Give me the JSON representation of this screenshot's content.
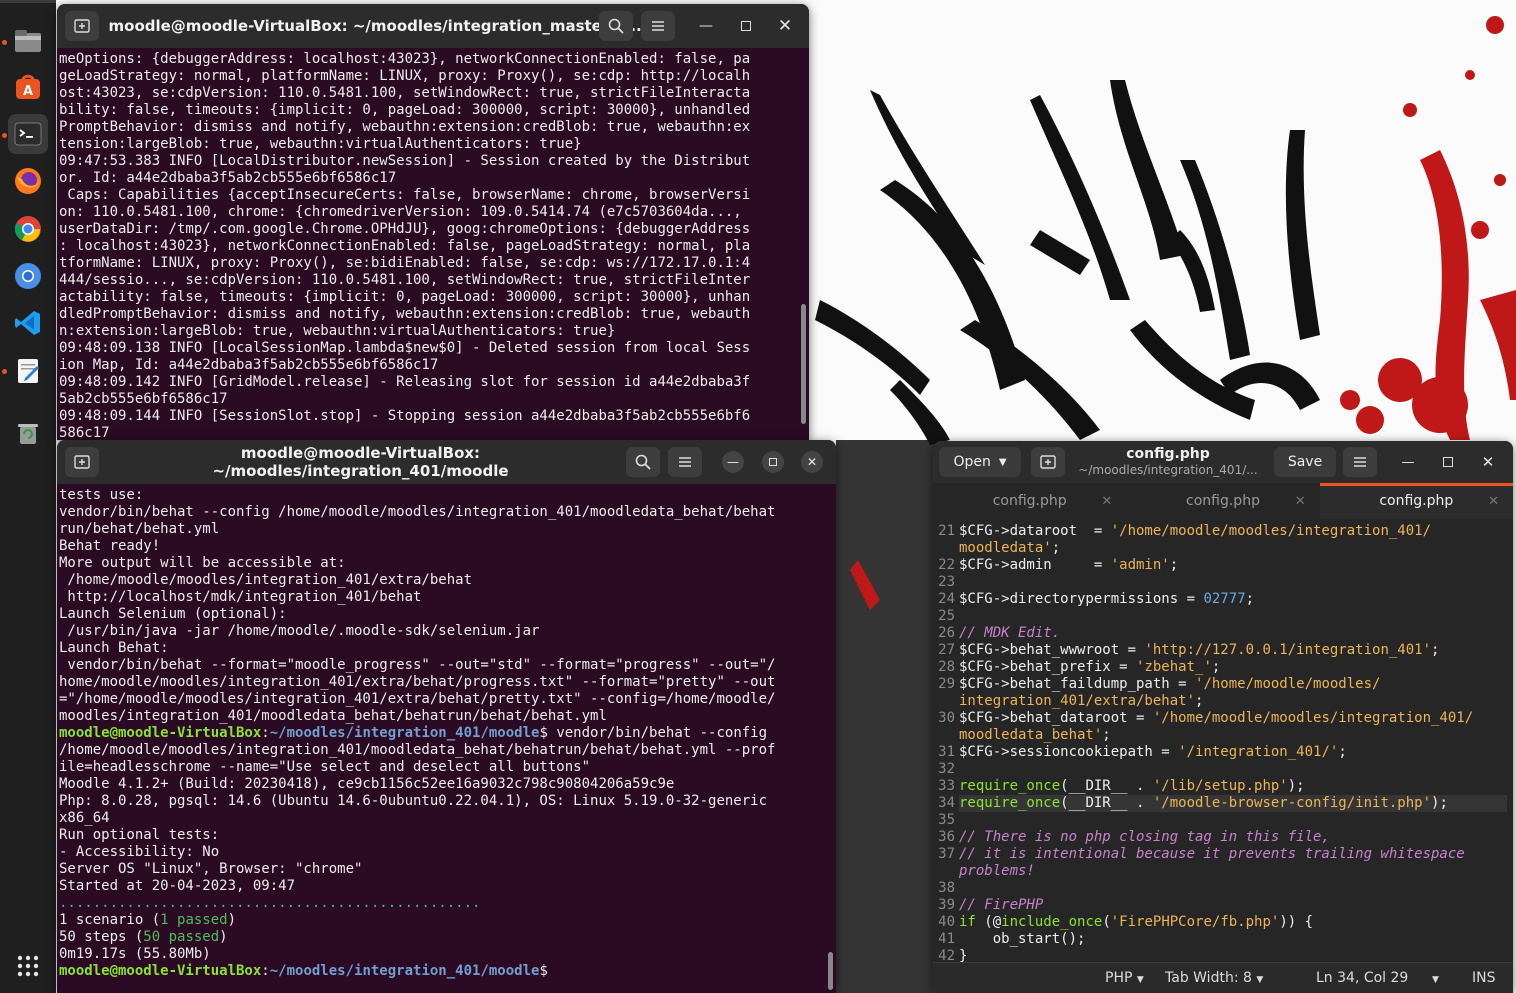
{
  "dock": {
    "items": [
      {
        "name": "files-icon"
      },
      {
        "name": "software-icon"
      },
      {
        "name": "terminal-icon"
      },
      {
        "name": "firefox-icon"
      },
      {
        "name": "chrome-icon"
      },
      {
        "name": "chromium-icon"
      },
      {
        "name": "vscode-icon"
      },
      {
        "name": "text-editor-icon"
      },
      {
        "name": "trash-icon"
      },
      {
        "name": "app-grid-icon"
      }
    ]
  },
  "terminal1": {
    "title": "moodle@moodle-VirtualBox: ~/moodles/integration_master/m...",
    "lines": [
      "meOptions: {debuggerAddress: localhost:43023}, networkConnectionEnabled: false, pa",
      "geLoadStrategy: normal, platformName: LINUX, proxy: Proxy(), se:cdp: http://localh",
      "ost:43023, se:cdpVersion: 110.0.5481.100, setWindowRect: true, strictFileInteracta",
      "bility: false, timeouts: {implicit: 0, pageLoad: 300000, script: 30000}, unhandled",
      "PromptBehavior: dismiss and notify, webauthn:extension:credBlob: true, webauthn:ex",
      "tension:largeBlob: true, webauthn:virtualAuthenticators: true}",
      "09:47:53.383 INFO [LocalDistributor.newSession] - Session created by the Distribut",
      "or. Id: a44e2dbaba3f5ab2cb555e6bf6586c17",
      " Caps: Capabilities {acceptInsecureCerts: false, browserName: chrome, browserVersi",
      "on: 110.0.5481.100, chrome: {chromedriverVersion: 109.0.5414.74 (e7c5703604da...,",
      "userDataDir: /tmp/.com.google.Chrome.OPHdJU}, goog:chromeOptions: {debuggerAddress",
      ": localhost:43023}, networkConnectionEnabled: false, pageLoadStrategy: normal, pla",
      "tformName: LINUX, proxy: Proxy(), se:bidiEnabled: false, se:cdp: ws://172.17.0.1:4",
      "444/sessio..., se:cdpVersion: 110.0.5481.100, setWindowRect: true, strictFileInter",
      "actability: false, timeouts: {implicit: 0, pageLoad: 300000, script: 30000}, unhan",
      "dledPromptBehavior: dismiss and notify, webauthn:extension:credBlob: true, webauth",
      "n:extension:largeBlob: true, webauthn:virtualAuthenticators: true}",
      "09:48:09.138 INFO [LocalSessionMap.lambda$new$0] - Deleted session from local Sess",
      "ion Map, Id: a44e2dbaba3f5ab2cb555e6bf6586c17",
      "09:48:09.142 INFO [GridModel.release] - Releasing slot for session id a44e2dbaba3f",
      "5ab2cb555e6bf6586c17",
      "09:48:09.144 INFO [SessionSlot.stop] - Stopping session a44e2dbaba3f5ab2cb555e6bf6",
      "586c17"
    ]
  },
  "terminal2": {
    "title": "moodle@moodle-VirtualBox: ~/moodles/integration_401/moodle",
    "lines_a": [
      "tests use:",
      "vendor/bin/behat --config /home/moodle/moodles/integration_401/moodledata_behat/behat",
      "run/behat/behat.yml",
      "Behat ready!",
      "More output will be accessible at:",
      " /home/moodle/moodles/integration_401/extra/behat",
      " http://localhost/mdk/integration_401/behat",
      "Launch Selenium (optional):",
      " /usr/bin/java -jar /home/moodle/.moodle-sdk/selenium.jar",
      "Launch Behat:",
      " vendor/bin/behat --format=\"moodle_progress\" --out=\"std\" --format=\"progress\" --out=\"/",
      "home/moodle/moodles/integration_401/extra/behat/progress.txt\" --format=\"pretty\" --out",
      "=\"/home/moodle/moodles/integration_401/extra/behat/pretty.txt\" --config=/home/moodle/",
      "moodles/integration_401/moodledata_behat/behatrun/behat/behat.yml"
    ],
    "prompt_user": "moodle@moodle-VirtualBox",
    "prompt_path": "~/moodles/integration_401/moodle",
    "command_1": " vendor/bin/behat --config",
    "lines_b": [
      "/home/moodle/moodles/integration_401/moodledata_behat/behatrun/behat/behat.yml --prof",
      "ile=headlesschrome --name=\"Use select and deselect all buttons\"",
      "Moodle 4.1.2+ (Build: 20230418), ce9cb1156c52ee16a9032c798c90804206a59c9e",
      "Php: 8.0.28, pgsql: 14.6 (Ubuntu 14.6-0ubuntu0.22.04.1), OS: Linux 5.19.0-32-generic",
      "x86_64",
      "Run optional tests:",
      "- Accessibility: No",
      "Server OS \"Linux\", Browser: \"chrome\"",
      "Started at 20-04-2023, 09:47"
    ],
    "dots": "..................................................",
    "blank": "",
    "scenario_a": "1 scenario (",
    "scenario_b": "1 passed",
    "scenario_c": ")",
    "steps_a": "50 steps (",
    "steps_b": "50 passed",
    "steps_c": ")",
    "time": "0m19.17s (55.80Mb)",
    "prompt_end": "$"
  },
  "editor": {
    "open_label": "Open",
    "save_label": "Save",
    "title": "config.php",
    "subtitle": "~/moodles/integration_401/...",
    "tabs": [
      "config.php",
      "config.php",
      "config.php"
    ],
    "status": {
      "language": "PHP",
      "tab_width": "Tab Width: 8",
      "position": "Ln 34, Col 29",
      "mode": "INS"
    }
  }
}
